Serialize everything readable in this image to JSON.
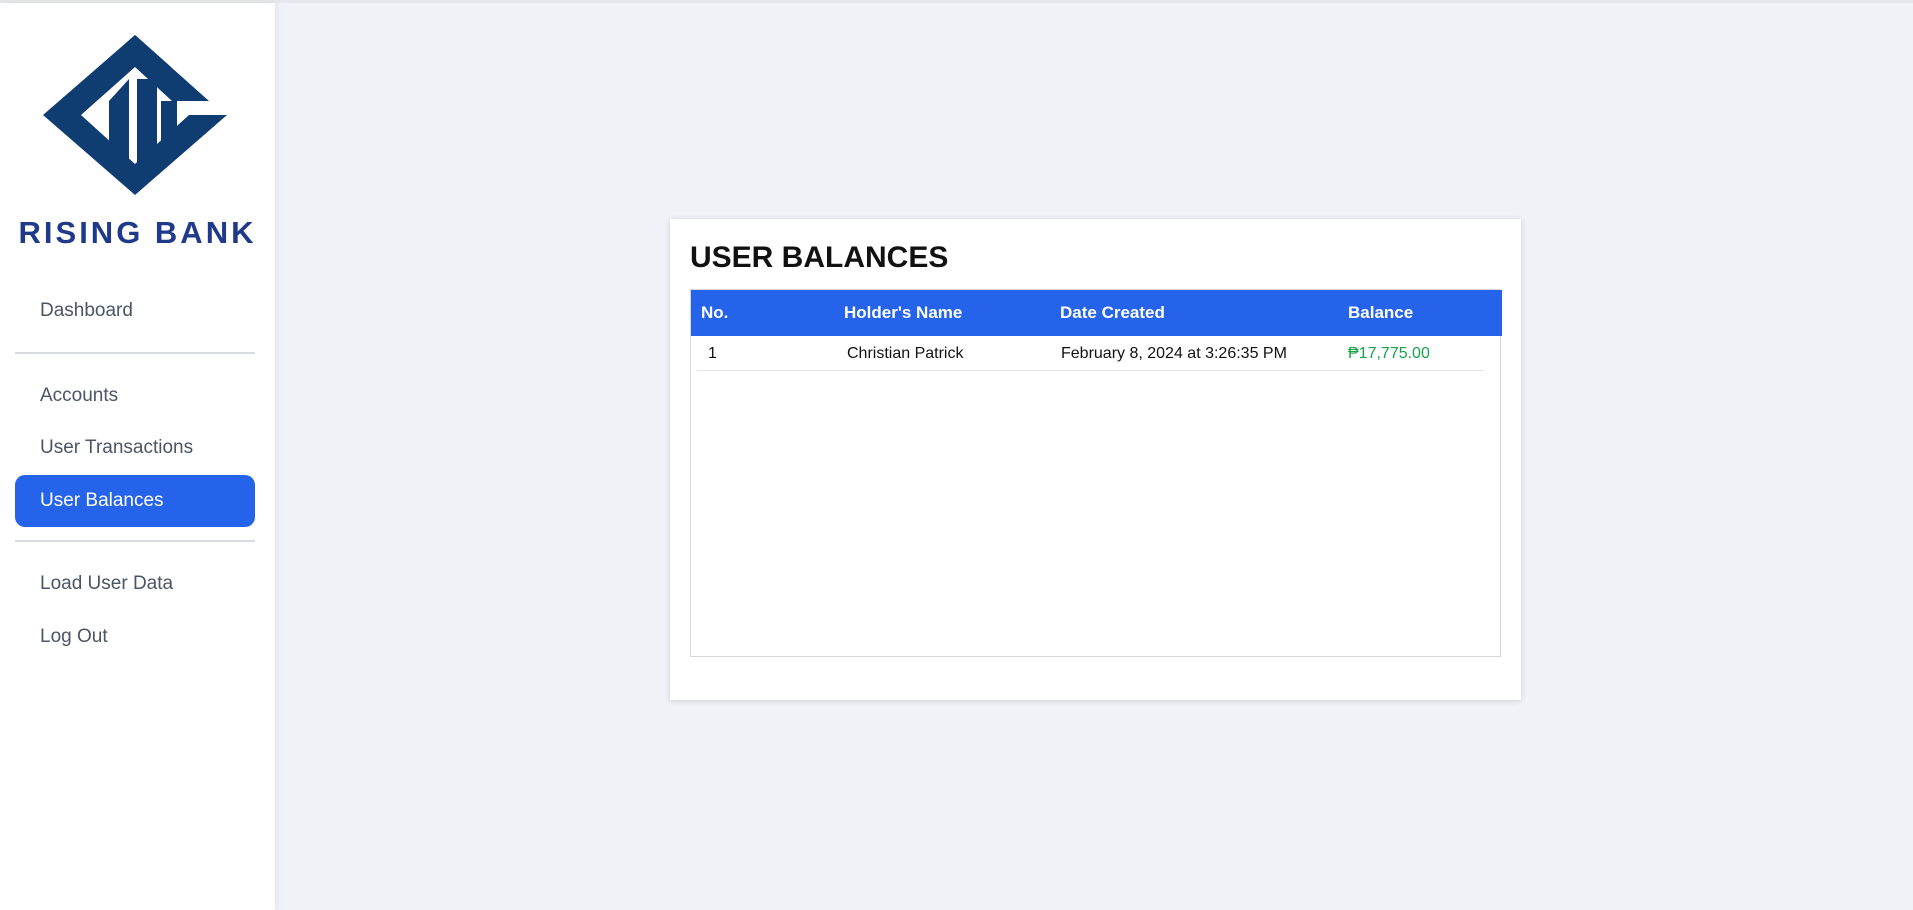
{
  "colors": {
    "accent": "#2563eb",
    "brand": "#0f3d72",
    "brand_text": "#1f3a8a",
    "positive": "#16a34a"
  },
  "sidebar": {
    "brand": "RISING BANK",
    "logo_icon": "rising-bank-diamond-logo",
    "items": [
      {
        "label": "Dashboard",
        "active": false
      },
      {
        "label": "Accounts",
        "active": false
      },
      {
        "label": "User Transactions",
        "active": false
      },
      {
        "label": "User Balances",
        "active": true
      },
      {
        "label": "Load User Data",
        "active": false
      },
      {
        "label": "Log Out",
        "active": false
      }
    ]
  },
  "main": {
    "title": "USER BALANCES",
    "table": {
      "columns": [
        "No.",
        "Holder's Name",
        "Date Created",
        "Balance"
      ],
      "rows": [
        {
          "no": "1",
          "holder_name": "Christian Patrick",
          "date_created": "February 8, 2024 at 3:26:35 PM",
          "balance": "₱17,775.00"
        }
      ]
    }
  }
}
